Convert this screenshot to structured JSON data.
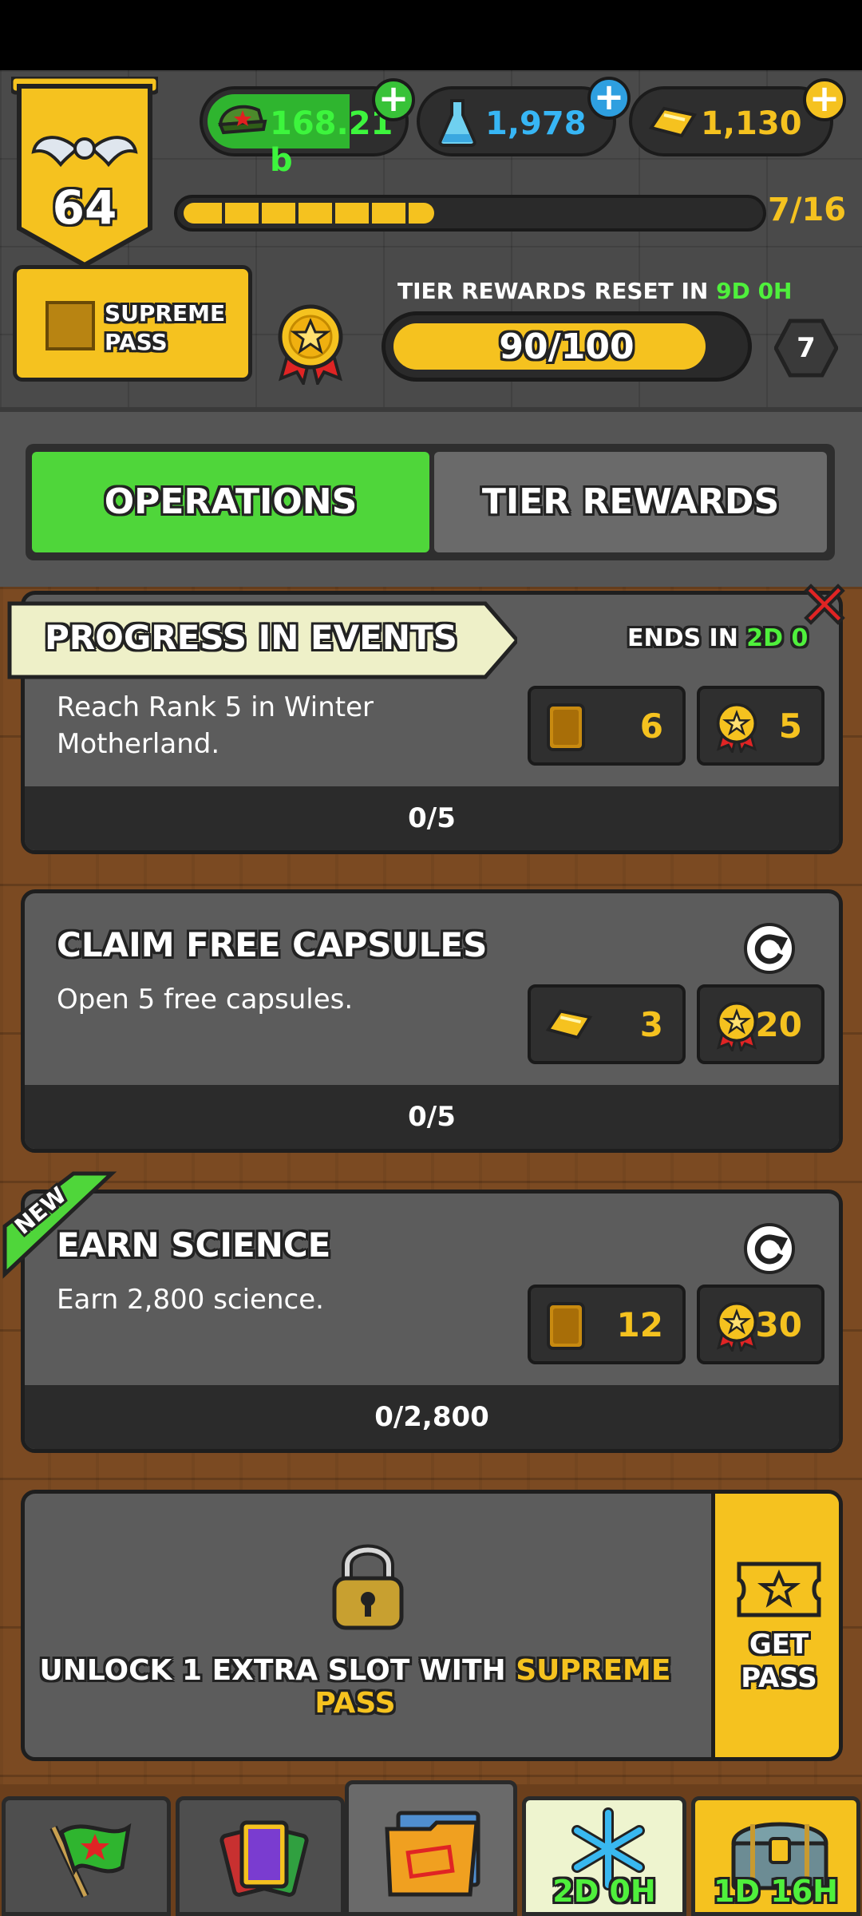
{
  "header": {
    "rank": "64",
    "currency": {
      "money": "168.21 b",
      "science": "1,978",
      "gold": "1,130"
    },
    "xp_progress": "7/16",
    "xp_fraction": 0.4375
  },
  "pass": {
    "supreme_label": "SUPREME PASS",
    "tier_reset_label": "TIER REWARDS RESET IN",
    "tier_reset_time": "9D 0H",
    "tier_progress": "90/100",
    "tier_fraction": 0.9,
    "tier_level": "7"
  },
  "tabs": {
    "operations": "OPERATIONS",
    "tier_rewards": "TIER REWARDS"
  },
  "events_task": {
    "title": "PROGRESS IN EVENTS",
    "ends_label": "ENDS IN",
    "ends_time": "2D 0",
    "desc_line1": "Reach Rank 5 in Winter",
    "desc_line2": "Motherland.",
    "reward_cards": "6",
    "reward_medals": "5",
    "progress": "0/5"
  },
  "capsules_task": {
    "title": "CLAIM FREE CAPSULES",
    "desc": "Open 5 free capsules.",
    "reward_gold": "3",
    "reward_medals": "20",
    "progress": "0/5"
  },
  "science_task": {
    "badge": "NEW",
    "title": "EARN SCIENCE",
    "desc": "Earn 2,800 science.",
    "reward_cards": "12",
    "reward_medals": "30",
    "progress": "0/2,800"
  },
  "locked_slot": {
    "text_prefix": "UNLOCK 1 EXTRA SLOT WITH",
    "text_highlight": "SUPREME PASS",
    "get_pass_line1": "GET",
    "get_pass_line2": "PASS"
  },
  "bottom_nav": {
    "event_timer": "2D 0H",
    "chest_timer": "1D 16H"
  },
  "colors": {
    "accent_green": "#4fd63a",
    "accent_yellow": "#f5c21f",
    "timer_green": "#4ff03c"
  }
}
